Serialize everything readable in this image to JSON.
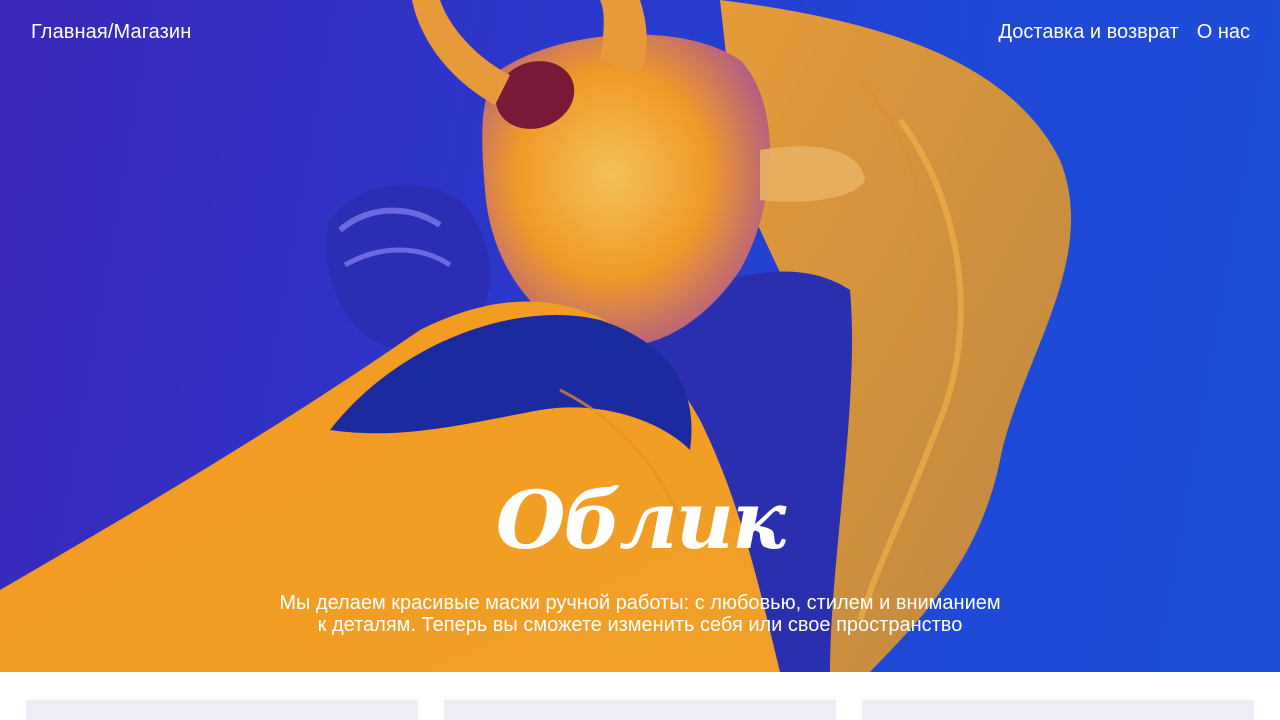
{
  "nav": {
    "home": "Главная",
    "separator": "/",
    "shop": "Магазин",
    "delivery": "Доставка и возврат",
    "about": "О нас"
  },
  "hero": {
    "logo": "Облик",
    "tagline_line1": "Мы делаем красивые маски ручной работы: с любовью, стилем и вниманием",
    "tagline_line2": "к деталям. Теперь вы сможете изменить себя или свое пространство"
  },
  "colors": {
    "background_blue": "#2d35c9",
    "accent_orange": "#f08c10",
    "card_bg": "#efecf6"
  }
}
